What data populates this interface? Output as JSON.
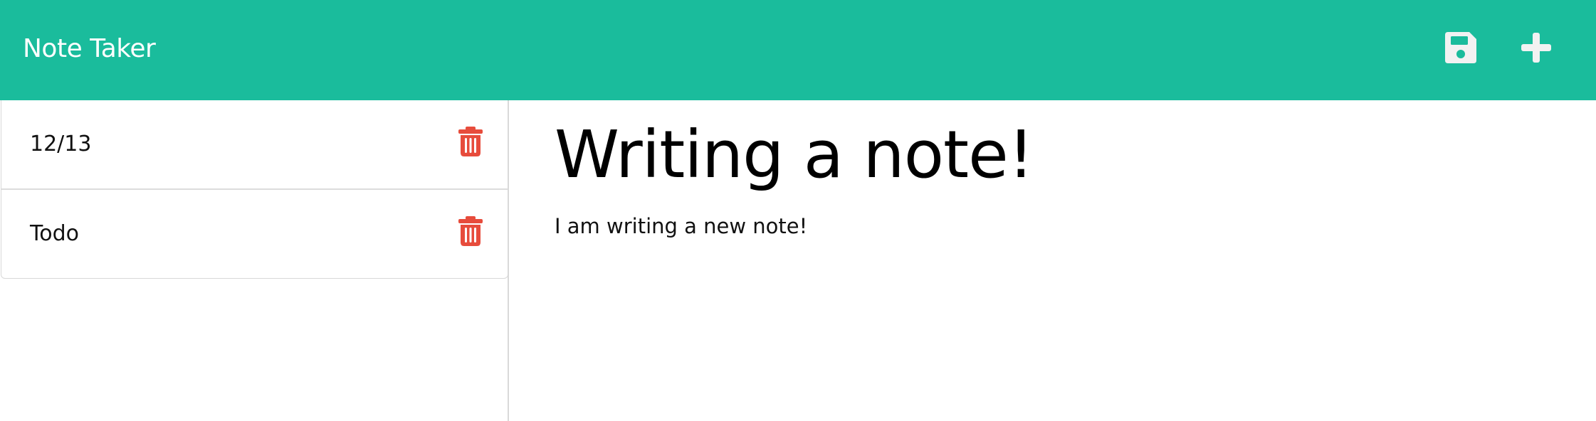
{
  "app": {
    "brand": "Note Taker"
  },
  "toolbar": {
    "save_icon": "save-icon",
    "add_icon": "plus-icon"
  },
  "sidebar": {
    "notes": [
      {
        "title": "12/13",
        "delete_icon": "trash-icon"
      },
      {
        "title": "Todo",
        "delete_icon": "trash-icon"
      }
    ]
  },
  "editor": {
    "title": "Writing a note!",
    "body": "I am writing a new note!"
  },
  "colors": {
    "navbar": "#1abc9c",
    "delete": "#e74c3c",
    "nav_icon": "#ffffff"
  }
}
